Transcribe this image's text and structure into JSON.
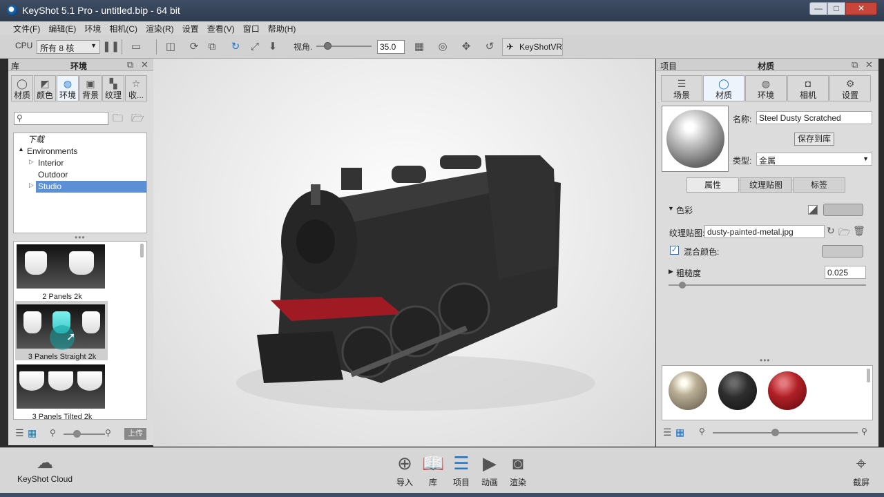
{
  "window": {
    "title": "KeyShot 5.1 Pro - untitled.bip - 64 bit",
    "min_glyph": "—",
    "max_glyph": "□",
    "close_glyph": "✕"
  },
  "menu": [
    "文件(F)",
    "编辑(E)",
    "环境",
    "相机(C)",
    "渲染(R)",
    "设置",
    "查看(V)",
    "窗口",
    "帮助(H)"
  ],
  "toolbar": {
    "cpu_label": "CPU",
    "cores_value": "所有 8 核",
    "fov_label": "视角.",
    "fov_value": "35.0",
    "vr_label": "KeyShotVR"
  },
  "left_panel": {
    "header_left": "库",
    "header_center": "环境",
    "tabs": [
      "材质",
      "颜色",
      "环境",
      "背景",
      "纹理",
      "收..."
    ],
    "tree": {
      "download": "下载",
      "root": "Environments",
      "children": [
        "Interior",
        "Outdoor",
        "Studio"
      ]
    },
    "thumbnails": [
      "2 Panels 2k",
      "3 Panels Straight 2k",
      "3 Panels Tilted 2k"
    ],
    "upload_label": "上传"
  },
  "right_panel": {
    "header_left": "项目",
    "header_center": "材质",
    "tabs": [
      "场景",
      "材质",
      "环境",
      "相机",
      "设置"
    ],
    "name_label": "名称:",
    "name_value": "Steel Dusty Scratched",
    "save_button": "保存到库",
    "type_label": "类型:",
    "type_value": "金属",
    "subtabs": [
      "属性",
      "纹理贴图",
      "标签"
    ],
    "color_label": "色彩",
    "texture_label": "纹理贴图:",
    "texture_value": "dusty-painted-metal.jpg",
    "blend_label": "混合颜色:",
    "roughness_label": "粗糙度",
    "roughness_value": "0.025",
    "colors": {
      "swatch": "#bdbdbd",
      "blend": "#c8c8c8",
      "ball_1": "#b9ad95",
      "ball_2": "#2e2e2e",
      "ball_3": "#b02026"
    }
  },
  "bottom_bar": {
    "cloud_label": "KeyShot Cloud",
    "buttons": [
      "导入",
      "库",
      "项目",
      "动画",
      "渲染"
    ],
    "screenshot_label": "截屏"
  }
}
